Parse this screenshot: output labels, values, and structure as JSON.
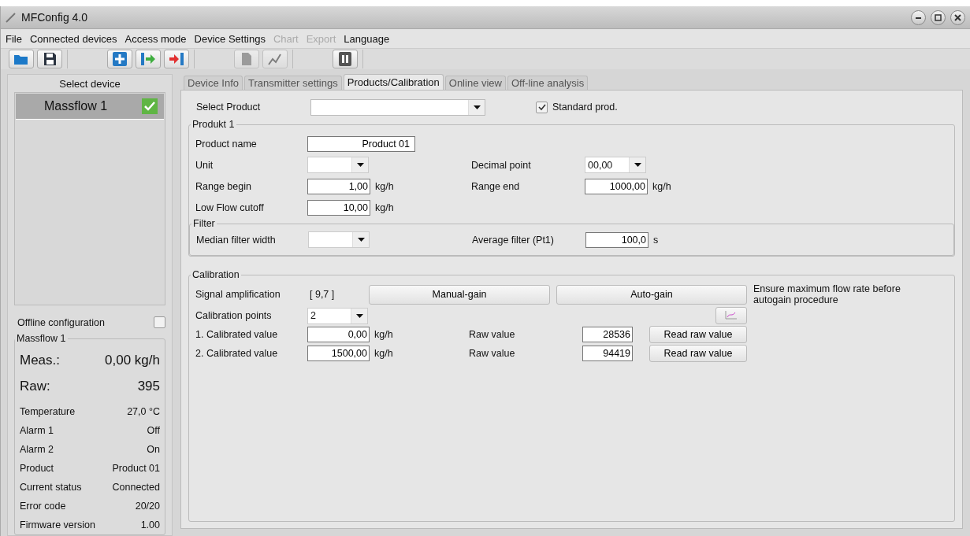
{
  "window": {
    "title": "MFConfig 4.0"
  },
  "menu": [
    {
      "label": "File",
      "disabled": false
    },
    {
      "label": "Connected devices",
      "disabled": false
    },
    {
      "label": "Access mode",
      "disabled": false
    },
    {
      "label": "Device Settings",
      "disabled": false
    },
    {
      "label": "Chart",
      "disabled": true
    },
    {
      "label": "Export",
      "disabled": true
    },
    {
      "label": "Language",
      "disabled": false
    }
  ],
  "toolbar": [
    [
      {
        "kind": "open",
        "disabled": false
      },
      {
        "kind": "save",
        "disabled": false
      }
    ],
    [
      {
        "kind": "add",
        "disabled": false
      },
      {
        "kind": "connect",
        "disabled": false
      },
      {
        "kind": "disconnect",
        "disabled": false
      }
    ],
    [
      {
        "kind": "report",
        "disabled": true
      },
      {
        "kind": "chart",
        "disabled": true
      }
    ],
    [
      {
        "kind": "pause",
        "disabled": false
      }
    ]
  ],
  "sidebar": {
    "title": "Select device",
    "devices": [
      {
        "name": "Massflow 1",
        "selected": true,
        "connected": true
      }
    ],
    "offline": {
      "label": "Offline configuration",
      "checked": false
    },
    "status": {
      "title": "Massflow 1",
      "big_rows": [
        {
          "label": "Meas.:",
          "value": "0,00 kg/h"
        },
        {
          "label": "Raw:",
          "value": "395"
        }
      ],
      "rows": [
        {
          "label": "Temperature",
          "value": "27,0 °C"
        },
        {
          "label": "Alarm 1",
          "value": "Off"
        },
        {
          "label": "Alarm 2",
          "value": "On"
        },
        {
          "label": "Product",
          "value": "Product 01"
        },
        {
          "label": "Current status",
          "value": "Connected"
        },
        {
          "label": "Error code",
          "value": "20/20"
        },
        {
          "label": "Firmware version",
          "value": "1.00"
        }
      ]
    }
  },
  "tabs": [
    {
      "label": "Device Info",
      "selected": false
    },
    {
      "label": "Transmitter settings",
      "selected": false
    },
    {
      "label": "Products/Calibration",
      "selected": true
    },
    {
      "label": "Online view",
      "selected": false
    },
    {
      "label": "Off-line analysis",
      "selected": false
    }
  ],
  "select_product": {
    "label": "Select Product"
  },
  "standard_prod": {
    "label": "Standard prod.",
    "checked": true
  },
  "product_group": {
    "title": "Produkt 1",
    "rows": [
      [
        {
          "label": "Product name",
          "kind": "wide_text",
          "value": "Product 01"
        }
      ],
      [
        {
          "label": "Unit",
          "kind": "select"
        },
        {
          "label": "Decimal point",
          "kind": "select",
          "value": "00,00"
        }
      ],
      [
        {
          "label": "Range begin",
          "kind": "text",
          "value": "1,00",
          "unit": "kg/h"
        },
        {
          "label": "Range end",
          "kind": "text",
          "value": "1000,00",
          "unit": "kg/h"
        }
      ],
      [
        {
          "label": "Low Flow cutoff",
          "kind": "text",
          "value": "10,00",
          "unit": "kg/h"
        }
      ]
    ]
  },
  "filter_group": {
    "title": "Filter",
    "rows": [
      [
        {
          "label": "Median filter width",
          "kind": "select"
        },
        {
          "label": "Average filter (Pt1)",
          "kind": "text",
          "value": "100,0",
          "unit": "s"
        }
      ]
    ]
  },
  "calibration": {
    "title": "Calibration",
    "signal": {
      "label": "Signal amplification",
      "value": "[ 9,7 ]"
    },
    "buttons": [
      "Manual-gain",
      "Auto-gain"
    ],
    "note": "Ensure maximum flow rate before autogain procedure",
    "points": {
      "label": "Calibration points",
      "value": "2"
    },
    "values": [
      {
        "label": "1. Calibrated value",
        "value": "0,00",
        "unit": "kg/h",
        "raw_label": "Raw value",
        "raw_value": "28536",
        "button": "Read raw value"
      },
      {
        "label": "2. Calibrated value",
        "value": "1500,00",
        "unit": "kg/h",
        "raw_label": "Raw value",
        "raw_value": "94419",
        "button": "Read raw value"
      }
    ]
  }
}
